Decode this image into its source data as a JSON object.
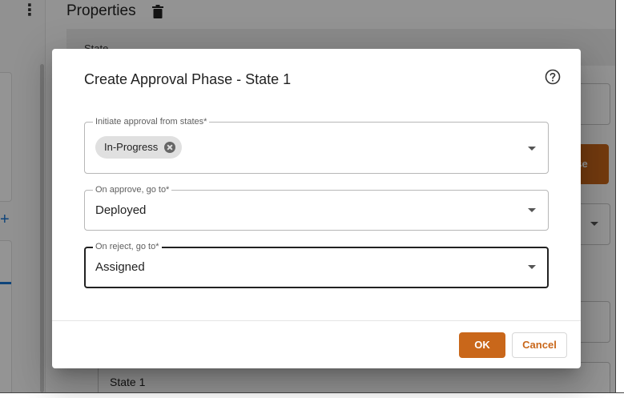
{
  "background": {
    "properties_title": "Properties",
    "state_label": "State",
    "phase_button_fragment": "ase",
    "state_field_value": "State 1"
  },
  "dialog": {
    "title": "Create Approval Phase - State 1",
    "fields": {
      "initiate": {
        "label": "Initiate approval from states*",
        "chips": [
          "In-Progress"
        ]
      },
      "on_approve": {
        "label": "On approve, go to*",
        "value": "Deployed"
      },
      "on_reject": {
        "label": "On reject, go to*",
        "value": "Assigned"
      }
    },
    "buttons": {
      "ok": "OK",
      "cancel": "Cancel"
    }
  },
  "colors": {
    "accent": "#c9671a",
    "overlay": "rgba(0,0,0,0.42)",
    "focus_border": "#222222",
    "link_blue": "#1976d2"
  },
  "icons": [
    "kebab-menu-icon",
    "trash-icon",
    "help-icon",
    "chip-remove-icon",
    "dropdown-icon"
  ]
}
